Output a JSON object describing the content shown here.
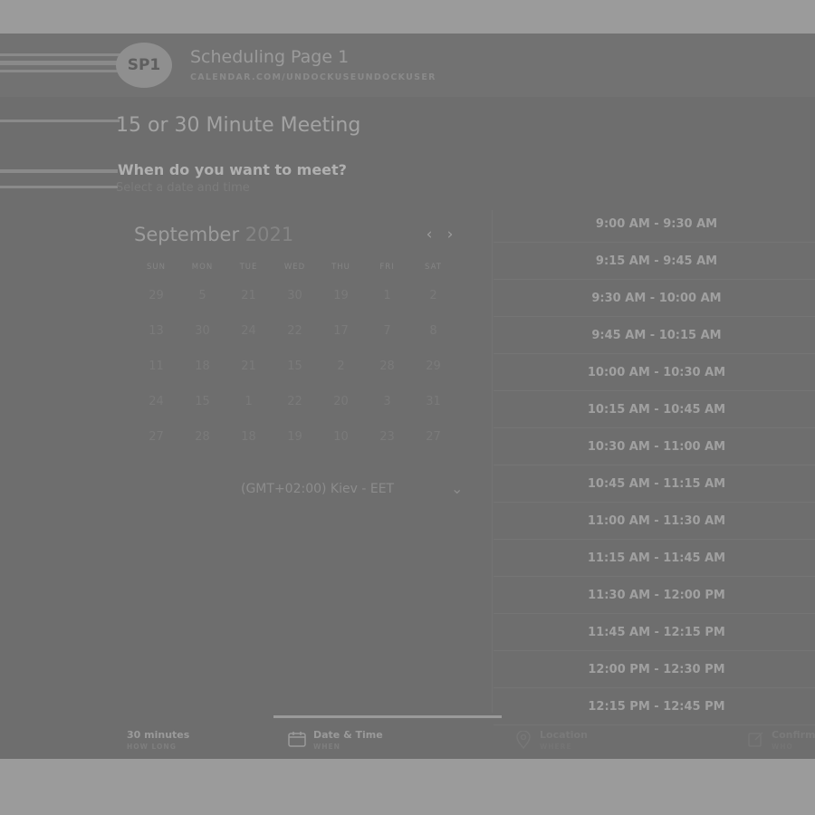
{
  "header": {
    "avatar_initials": "SP1",
    "page_name": "Scheduling Page 1",
    "page_url": "CALENDAR.COM/UNDOCKUSEUNDOCKUSER"
  },
  "meeting": {
    "title": "15 or 30 Minute Meeting",
    "question": "When do you want to meet?",
    "subtitle": "Select a date and time"
  },
  "calendar": {
    "month": "September",
    "year": "2021",
    "prev_icon": "‹",
    "next_icon": "›",
    "weekdays": [
      "SUN",
      "MON",
      "TUE",
      "WED",
      "THU",
      "FRI",
      "SAT"
    ],
    "weeks": [
      [
        "29",
        "5",
        "21",
        "30",
        "19",
        "1",
        "2"
      ],
      [
        "13",
        "30",
        "24",
        "22",
        "17",
        "7",
        "8"
      ],
      [
        "11",
        "18",
        "21",
        "15",
        "2",
        "28",
        "29"
      ],
      [
        "24",
        "15",
        "1",
        "22",
        "20",
        "3",
        "31"
      ],
      [
        "27",
        "28",
        "18",
        "19",
        "10",
        "23",
        "27"
      ]
    ]
  },
  "timezone": {
    "label": "(GMT+02:00) Kiev - EET",
    "chevron": "⌄"
  },
  "slots": [
    "9:00 AM - 9:30 AM",
    "9:15 AM - 9:45 AM",
    "9:30 AM - 10:00 AM",
    "9:45 AM - 10:15 AM",
    "10:00 AM - 10:30 AM",
    "10:15 AM - 10:45 AM",
    "10:30 AM - 11:00 AM",
    "10:45 AM - 11:15 AM",
    "11:00 AM - 11:30 AM",
    "11:15 AM - 11:45 AM",
    "11:30 AM - 12:00 PM",
    "11:45 AM - 12:15 PM",
    "12:00 PM - 12:30 PM",
    "12:15 PM - 12:45 PM"
  ],
  "steps": [
    {
      "title": "30 minutes",
      "sub": "HOW LONG",
      "icon": ""
    },
    {
      "title": "Date & Time",
      "sub": "WHEN",
      "icon": "calendar-icon"
    },
    {
      "title": "Location",
      "sub": "WHERE",
      "icon": "location-pin-icon"
    },
    {
      "title": "Confirm",
      "sub": "WHO",
      "icon": "edit-icon"
    }
  ],
  "colors": {
    "backdrop": "#9b9b9b",
    "panel": "#6e6e6e",
    "text": "#a0a0a0"
  }
}
